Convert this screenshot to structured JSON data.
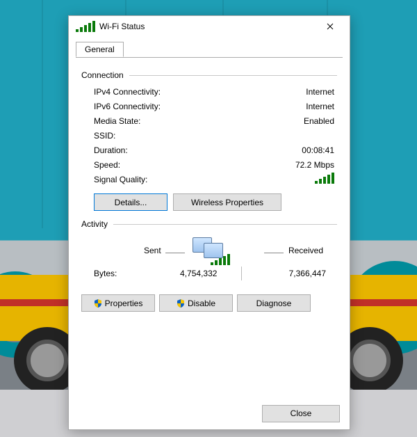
{
  "window": {
    "title": "Wi-Fi Status",
    "close_icon": "close-icon"
  },
  "tabs": {
    "general": "General"
  },
  "groups": {
    "connection": "Connection",
    "activity": "Activity"
  },
  "connection": {
    "ipv4_label": "IPv4 Connectivity:",
    "ipv4_value": "Internet",
    "ipv6_label": "IPv6 Connectivity:",
    "ipv6_value": "Internet",
    "media_label": "Media State:",
    "media_value": "Enabled",
    "ssid_label": "SSID:",
    "ssid_value": "",
    "duration_label": "Duration:",
    "duration_value": "00:08:41",
    "speed_label": "Speed:",
    "speed_value": "72.2 Mbps",
    "signal_label": "Signal Quality:",
    "signal_bars": 5
  },
  "buttons": {
    "details": "Details...",
    "wireless_properties": "Wireless Properties",
    "properties": "Properties",
    "disable": "Disable",
    "diagnose": "Diagnose",
    "close": "Close"
  },
  "activity": {
    "sent_label": "Sent",
    "received_label": "Received",
    "bytes_label": "Bytes:",
    "bytes_sent": "4,754,332",
    "bytes_received": "7,366,447"
  },
  "icons": {
    "wifi": "wifi-signal-icon",
    "shield": "uac-shield-icon"
  }
}
